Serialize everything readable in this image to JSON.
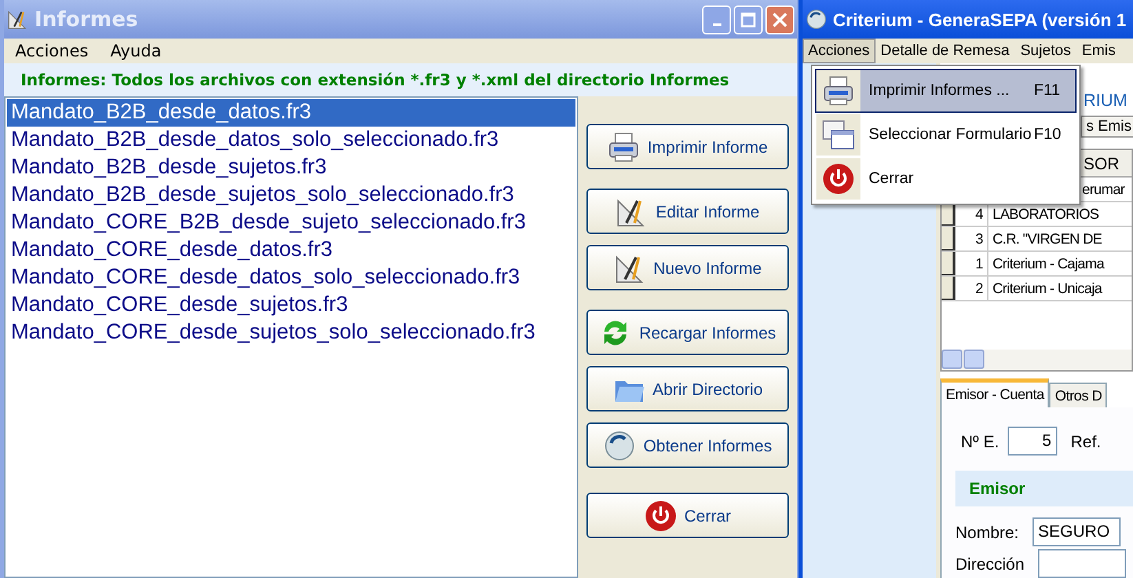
{
  "informes_window": {
    "title": "Informes",
    "menu": [
      "Acciones",
      "Ayuda"
    ],
    "header": "Informes: Todos los archivos con extensión *.fr3 y *.xml del directorio Informes",
    "files": [
      {
        "name": "Mandato_B2B_desde_datos.fr3",
        "selected": true
      },
      {
        "name": "Mandato_B2B_desde_datos_solo_seleccionado.fr3",
        "selected": false
      },
      {
        "name": "Mandato_B2B_desde_sujetos.fr3",
        "selected": false
      },
      {
        "name": "Mandato_B2B_desde_sujetos_solo_seleccionado.fr3",
        "selected": false
      },
      {
        "name": "Mandato_CORE_B2B_desde_sujeto_seleccionado.fr3",
        "selected": false
      },
      {
        "name": "Mandato_CORE_desde_datos.fr3",
        "selected": false
      },
      {
        "name": "Mandato_CORE_desde_datos_solo_seleccionado.fr3",
        "selected": false
      },
      {
        "name": "Mandato_CORE_desde_sujetos.fr3",
        "selected": false
      },
      {
        "name": "Mandato_CORE_desde_sujetos_solo_seleccionado.fr3",
        "selected": false
      }
    ],
    "buttons": [
      "Imprimir Informe",
      "Editar Informe",
      "Nuevo Informe",
      "Recargar Informes",
      "Abrir Directorio",
      "Obtener Informes",
      "Cerrar"
    ]
  },
  "main_window": {
    "title": "Criterium - GeneraSEPA (versión 1",
    "menu": [
      {
        "label": "Acciones",
        "selected": true
      },
      {
        "label": "Detalle de Remesa",
        "selected": false
      },
      {
        "label": "Sujetos",
        "selected": false
      },
      {
        "label": "Emis",
        "selected": false
      }
    ],
    "dropdown": [
      {
        "label": "Imprimir Informes ...",
        "shortcut": "F11",
        "selected": true
      },
      {
        "label": "Seleccionar Formulario",
        "shortcut": "F10",
        "selected": false
      },
      {
        "label": "Cerrar",
        "selected": false
      }
    ],
    "banner": "RIUM",
    "top_tab": "s Emis",
    "grid": {
      "column_header": "SOR",
      "rows": [
        {
          "column_2": "erumar"
        },
        {
          "number": "4",
          "column_2": "LABORATORIOS"
        },
        {
          "number": "3",
          "column_2": "C.R. \"VIRGEN DE"
        },
        {
          "number": "1",
          "column_2": "Criterium - Cajama"
        },
        {
          "number": "2",
          "column_2": "Criterium - Unicaja"
        }
      ]
    },
    "bottom_tabs": [
      {
        "label": "Emisor - Cuenta",
        "selected": true
      },
      {
        "label": "Otros D",
        "selected": false
      }
    ],
    "form": {
      "ne_label": "Nº E.",
      "ne_value": "5",
      "ref_label": "Ref.",
      "section": "Emisor",
      "nombre_label": "Nombre:",
      "nombre_value": "SEGURO",
      "direccion_label": "Dirección"
    }
  }
}
